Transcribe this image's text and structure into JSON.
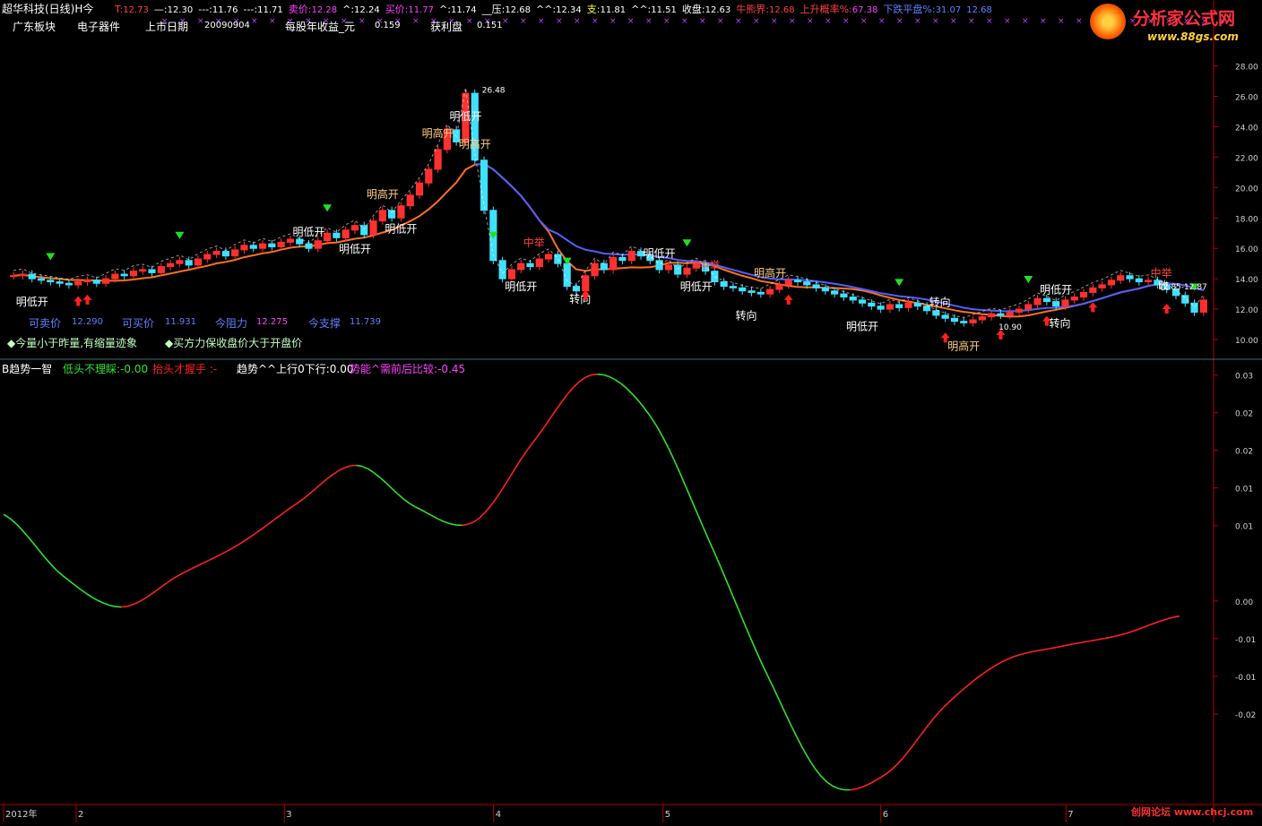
{
  "header": {
    "title": "超华科技(日线)H今",
    "items": [
      {
        "label": "T",
        "value": "12.73",
        "color": "#ff4040",
        "vcolor": "#ff4040"
      },
      {
        "label": "—",
        "value": "12.30",
        "color": "#ffffff",
        "vcolor": "#ffffff"
      },
      {
        "label": "---",
        "value": "11.76",
        "color": "#ffffff",
        "vcolor": "#ffffff"
      },
      {
        "label": "---",
        "value": "11.71",
        "color": "#ffffff",
        "vcolor": "#ffffff"
      },
      {
        "label": "卖价",
        "value": "12.28",
        "color": "#ff40ff",
        "vcolor": "#ff40ff"
      },
      {
        "label": "^",
        "value": "12.24",
        "color": "#ffffff",
        "vcolor": "#ffffff"
      },
      {
        "label": "买价",
        "value": "11.77",
        "color": "#ff40ff",
        "vcolor": "#ff40ff"
      },
      {
        "label": "^",
        "value": "11.74",
        "color": "#ffffff",
        "vcolor": "#ffffff"
      },
      {
        "label": "__压",
        "value": "12.68",
        "color": "#ffffff",
        "vcolor": "#ffffff"
      },
      {
        "label": "^^",
        "value": "12.34",
        "color": "#ffffff",
        "vcolor": "#ffffff"
      },
      {
        "label": "支",
        "value": "11.81",
        "color": "#ffff40",
        "vcolor": "#ffffff"
      },
      {
        "label": "^^",
        "value": "11.51",
        "color": "#ffffff",
        "vcolor": "#ffffff"
      },
      {
        "label": "收盘",
        "value": "12.63",
        "color": "#ffffff",
        "vcolor": "#ffffff"
      },
      {
        "label": "牛熊界",
        "value": "12.68",
        "color": "#ff4040",
        "vcolor": "#ff4040"
      },
      {
        "label": "上升概率%",
        "value": "67.38",
        "color": "#ff4040",
        "vcolor": "#ff40ff"
      },
      {
        "label": "下跌平盘%",
        "value": "31.07",
        "color": "#6080ff",
        "vcolor": "#6080ff"
      },
      {
        "label": "",
        "value": "12.68",
        "color": "#6080ff",
        "vcolor": "#6080ff"
      }
    ]
  },
  "info_row": {
    "sector_label": "广东板块",
    "sector_value": "电子器件",
    "listing_label": "上市日期",
    "listing_value": "20090904",
    "eps_label": "每股年收益_元",
    "eps_value": "0.159",
    "profit_label": "获利盘",
    "profit_value": "0.151"
  },
  "price_box": {
    "sell_label": "可卖价",
    "sell_value": "12.290",
    "buy_label": "可买价",
    "buy_value": "11.931",
    "resist_label": "今阻力",
    "resist_value": "12.275",
    "support_label": "今支撑",
    "support_value": "11.739"
  },
  "notes": [
    "◆今量小于昨量,有缩量迹象",
    "◆买方力保收盘价大于开盘价"
  ],
  "indicator_header": {
    "name": "B趋势一智",
    "f1": "低头不理睬:-0.00",
    "f2": "抬头才握手 :-",
    "f3": "趋势^^上行0下行:0.00",
    "f4": "势能^需前后比较:-0.45"
  },
  "date_labels": [
    "2012年",
    "2",
    "3",
    "4",
    "5",
    "6",
    "7"
  ],
  "watermark": "创网论坛 www.chcj.com",
  "logo_text": "分析家公式网",
  "logo_url": "www.88gs.com",
  "colors": {
    "up": "#ff3030",
    "down": "#40e0ff",
    "ma_orange": "#ff7020",
    "ma_blue": "#5060ff",
    "osc_up": "#ff2020",
    "osc_down": "#30e030",
    "axis": "#b00000",
    "sep": "#3a7070",
    "label_white": "#ffffff"
  },
  "chart_data": [
    {
      "type": "candlestick",
      "title": "超华科技(日线)",
      "ylim": [
        9,
        28.8
      ],
      "yticks": [
        "28.00",
        "26.00",
        "24.00",
        "22.00",
        "20.00",
        "18.00",
        "16.00",
        "14.00",
        "12.00",
        "10.00"
      ],
      "x_months": [
        {
          "label": "2012年",
          "pos": 0
        },
        {
          "label": "2",
          "pos": 0.06
        },
        {
          "label": "3",
          "pos": 0.232
        },
        {
          "label": "4",
          "pos": 0.405
        },
        {
          "label": "5",
          "pos": 0.545
        },
        {
          "label": "6",
          "pos": 0.725
        },
        {
          "label": "7",
          "pos": 0.878
        }
      ],
      "close": [
        14.2,
        14.3,
        14.0,
        13.9,
        13.8,
        13.7,
        13.6,
        13.8,
        13.9,
        13.7,
        14.0,
        14.3,
        14.2,
        14.5,
        14.6,
        14.4,
        14.8,
        15.0,
        15.2,
        14.9,
        15.3,
        15.6,
        15.8,
        15.5,
        15.9,
        16.2,
        16.0,
        16.3,
        16.1,
        16.4,
        16.6,
        16.3,
        16.0,
        16.5,
        17.0,
        16.7,
        17.2,
        17.5,
        16.9,
        17.8,
        18.5,
        18.0,
        18.8,
        19.5,
        20.3,
        21.2,
        22.5,
        23.8,
        23.0,
        26.2,
        21.8,
        18.5,
        15.2,
        14.0,
        14.6,
        15.0,
        14.8,
        15.3,
        15.6,
        15.0,
        13.5,
        13.2,
        14.2,
        15.0,
        14.6,
        15.4,
        15.2,
        15.8,
        15.5,
        15.2,
        14.6,
        14.9,
        14.3,
        14.7,
        15.0,
        14.5,
        13.8,
        13.5,
        13.4,
        13.2,
        13.1,
        13.0,
        13.3,
        13.6,
        13.9,
        13.8,
        13.6,
        13.4,
        13.2,
        13.0,
        12.8,
        12.6,
        12.4,
        12.2,
        12.0,
        12.3,
        12.1,
        12.4,
        12.2,
        11.9,
        11.6,
        11.4,
        11.2,
        11.1,
        11.3,
        11.5,
        11.7,
        11.6,
        11.8,
        12.0,
        12.3,
        12.7,
        12.5,
        12.2,
        12.6,
        12.8,
        13.1,
        13.4,
        13.6,
        13.9,
        14.2,
        14.0,
        13.8,
        13.9,
        13.6,
        13.3,
        12.9,
        12.4,
        11.8,
        12.6
      ],
      "series": [
        {
          "name": "",
          "desc": "moving average (orange)"
        },
        {
          "name": "",
          "desc": "trend line (blue)"
        }
      ],
      "signals": [
        {
          "text": "明低开",
          "idx": 2
        },
        {
          "text": "明低开",
          "idx": 32
        },
        {
          "text": "明低开",
          "idx": 37
        },
        {
          "text": "明高开",
          "idx": 40
        },
        {
          "text": "明低开",
          "idx": 42
        },
        {
          "text": "明高开",
          "idx": 46
        },
        {
          "text": "明低开",
          "idx": 49
        },
        {
          "text": "明高开",
          "idx": 50
        },
        {
          "text": "明低开",
          "idx": 55
        },
        {
          "text": "中举",
          "idx": 57
        },
        {
          "text": "转向",
          "idx": 62
        },
        {
          "text": "明低开",
          "idx": 70
        },
        {
          "text": "明低开",
          "idx": 74
        },
        {
          "text": "中举",
          "idx": 76
        },
        {
          "text": "转向",
          "idx": 80
        },
        {
          "text": "明高开",
          "idx": 82
        },
        {
          "text": "明低开",
          "idx": 92
        },
        {
          "text": "转向",
          "idx": 101
        },
        {
          "text": "明高开",
          "idx": 103
        },
        {
          "text": "明低开",
          "idx": 113
        },
        {
          "text": "转向",
          "idx": 114
        },
        {
          "text": "中举",
          "idx": 125
        },
        {
          "text": "明低开",
          "idx": 143
        },
        {
          "text": "转向",
          "idx": 149
        }
      ],
      "annotations": [
        {
          "text": "26.48",
          "idx": 50
        },
        {
          "text": "10.90",
          "idx": 106
        },
        {
          "text": "12.85-12.87",
          "idx": 146
        },
        {
          "text": "收",
          "idx": 150
        }
      ]
    },
    {
      "type": "line",
      "title": "B趋势一智",
      "ylim": [
        -0.027,
        0.031
      ],
      "yticks": [
        "0.03",
        "0.02",
        "0.02",
        "0.01",
        "0.01",
        "0.00",
        "-0.01",
        "-0.01",
        "-0.02"
      ],
      "x": [
        0,
        0.05,
        0.1,
        0.15,
        0.2,
        0.25,
        0.3,
        0.35,
        0.4,
        0.45,
        0.5,
        0.55,
        0.6,
        0.65,
        0.7,
        0.75,
        0.8,
        0.85,
        0.9,
        0.95,
        1.0
      ],
      "values": [
        0.0115,
        0.0034,
        -0.0008,
        0.0035,
        0.0075,
        0.013,
        0.018,
        0.0125,
        0.0105,
        0.021,
        0.03,
        0.0245,
        0.008,
        -0.01,
        -0.024,
        -0.023,
        -0.014,
        -0.008,
        -0.006,
        -0.0045,
        -0.002
      ]
    }
  ]
}
